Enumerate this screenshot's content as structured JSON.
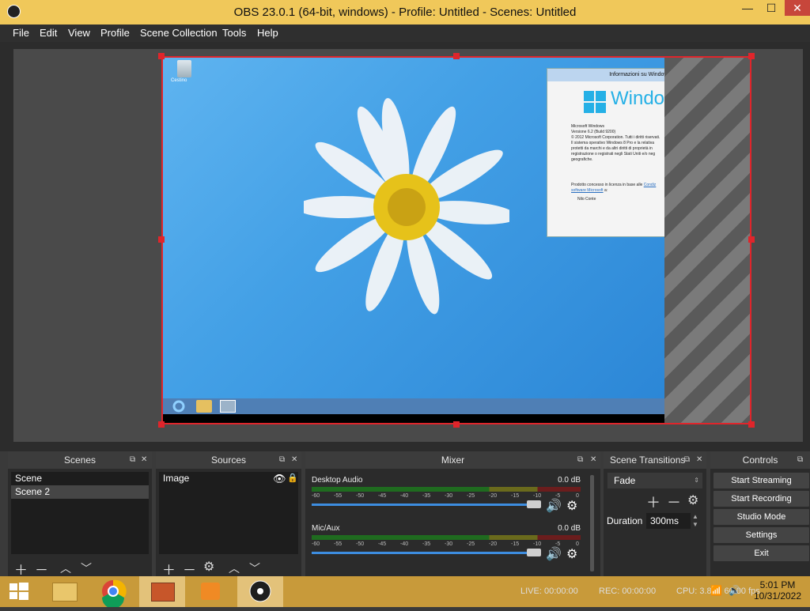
{
  "window": {
    "title": "OBS 23.0.1 (64-bit, windows) - Profile: Untitled - Scenes: Untitled",
    "minimize_glyph": "—",
    "maximize_glyph": "☐",
    "close_glyph": "✕"
  },
  "menu": [
    "File",
    "Edit",
    "View",
    "Profile",
    "Scene Collection",
    "Tools",
    "Help"
  ],
  "preview": {
    "recycle_bin_label": "Cestino",
    "about_dialog": {
      "title": "Informazioni su Windows",
      "brand": "Windows",
      "lines": [
        "Microsoft Windows",
        "Versione 6.2 (Build 9200)",
        "© 2012 Microsoft Corporation. Tutti i diritti riservati.",
        "Il sistema operativo Windows 8 Pro e la relativa",
        "protetti da marchi e da altri diritti di proprietà in",
        "registrazione o registrati negli Stati Uniti e/o neg",
        "geografiche."
      ],
      "license_text": "Prodotto concesso in licenza in base alle",
      "license_link": "Condiz",
      "license_link2": "software Microsoft",
      "license_suffix": "a:",
      "owner": "Nilo Conte"
    }
  },
  "panels": {
    "scenes": {
      "title": "Scenes",
      "items": [
        "Scene",
        "Scene 2"
      ],
      "selected_index": 1
    },
    "sources": {
      "title": "Sources",
      "items": [
        "Image"
      ]
    },
    "mixer": {
      "title": "Mixer",
      "channels": [
        {
          "name": "Desktop Audio",
          "level": "0.0 dB"
        },
        {
          "name": "Mic/Aux",
          "level": "0.0 dB"
        }
      ],
      "ticks": [
        "-60",
        "-55",
        "-50",
        "-45",
        "-40",
        "-35",
        "-30",
        "-25",
        "-20",
        "-15",
        "-10",
        "-5",
        "0"
      ]
    },
    "transitions": {
      "title": "Scene Transitions",
      "selected": "Fade",
      "duration_label": "Duration",
      "duration_value": "300ms"
    },
    "controls": {
      "title": "Controls",
      "buttons": [
        "Start Streaming",
        "Start Recording",
        "Studio Mode",
        "Settings",
        "Exit"
      ]
    }
  },
  "status": {
    "live": "LIVE: 00:00:00",
    "rec": "REC: 00:00:00",
    "cpu": "CPU: 3.8%, 60.00 fps"
  },
  "clock": {
    "time": "5:01 PM",
    "date": "10/31/2022"
  },
  "colors": {
    "title_bar": "#f0c85a",
    "selection": "#e0252b",
    "accent_blue": "#3d8de0",
    "taskbar": "#c89a3a"
  }
}
